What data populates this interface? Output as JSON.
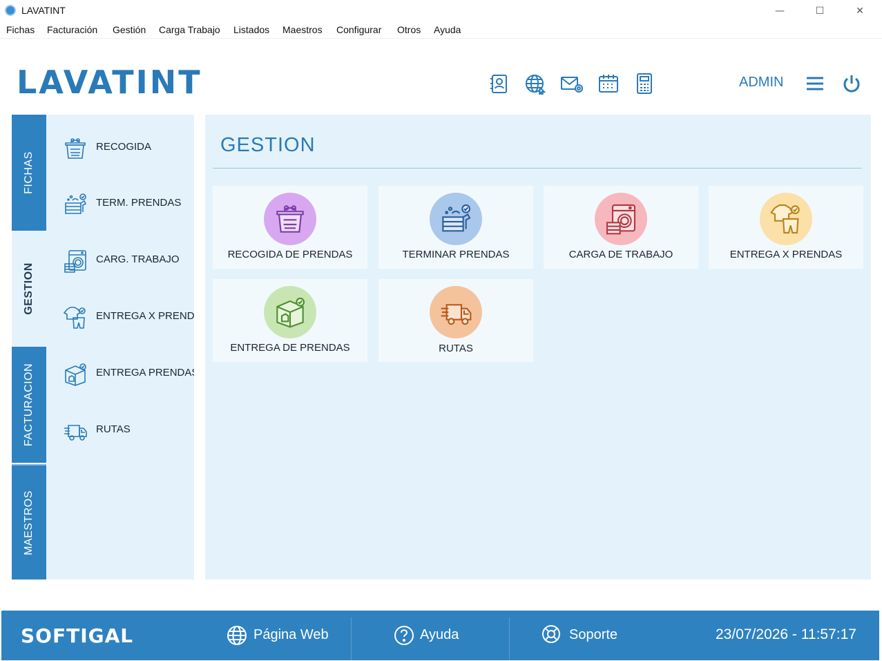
{
  "window": {
    "title": "LAVATINT"
  },
  "menu": [
    "Fichas",
    "Facturación",
    "Gestión",
    "Carga Trabajo",
    "Listados",
    "Maestros",
    "Configurar",
    "Otros",
    "Ayuda"
  ],
  "header": {
    "logo": "LAVATINT",
    "icons": [
      "contacts-icon",
      "globe-icon",
      "mail-icon",
      "calendar-icon",
      "calculator-icon"
    ],
    "user": "ADMIN"
  },
  "vtabs": [
    "FICHAS",
    "GESTION",
    "FACTURACION",
    "MAESTROS"
  ],
  "active_tab": "GESTION",
  "sidebar": {
    "items": [
      {
        "label": "RECOGIDA",
        "icon": "laundry-basket-icon"
      },
      {
        "label": "TERM. PRENDAS",
        "icon": "folded-clothes-icon"
      },
      {
        "label": "CARG. TRABAJO",
        "icon": "washing-machine-icon"
      },
      {
        "label": "ENTREGA X PRENDAS",
        "icon": "garments-icon"
      },
      {
        "label": "ENTREGA PRENDAS",
        "icon": "delivery-box-icon"
      },
      {
        "label": "RUTAS",
        "icon": "truck-icon"
      }
    ]
  },
  "main": {
    "title": "GESTION",
    "tiles": [
      {
        "label": "RECOGIDA DE PRENDAS",
        "icon": "laundry-basket-icon",
        "color": "#d7a8f0"
      },
      {
        "label": "TERMINAR PRENDAS",
        "icon": "folded-clothes-icon",
        "color": "#a9c8ec"
      },
      {
        "label": "CARGA DE TRABAJO",
        "icon": "washing-machine-icon",
        "color": "#f6b8bd"
      },
      {
        "label": "ENTREGA X PRENDAS",
        "icon": "garments-icon",
        "color": "#fbe0a8"
      },
      {
        "label": "ENTREGA DE PRENDAS",
        "icon": "delivery-box-icon",
        "color": "#c8e6b4"
      },
      {
        "label": "RUTAS",
        "icon": "truck-icon",
        "color": "#f4c39c"
      }
    ]
  },
  "footer": {
    "brand": "SOFTIGAL",
    "web": "Página Web",
    "help": "Ayuda",
    "support": "Soporte",
    "datetime": "23/07/2026 - 11:57:17"
  },
  "colors": {
    "accent": "#2f82c0",
    "panel": "#e4f3fb",
    "tile": "#f2f9fd"
  }
}
